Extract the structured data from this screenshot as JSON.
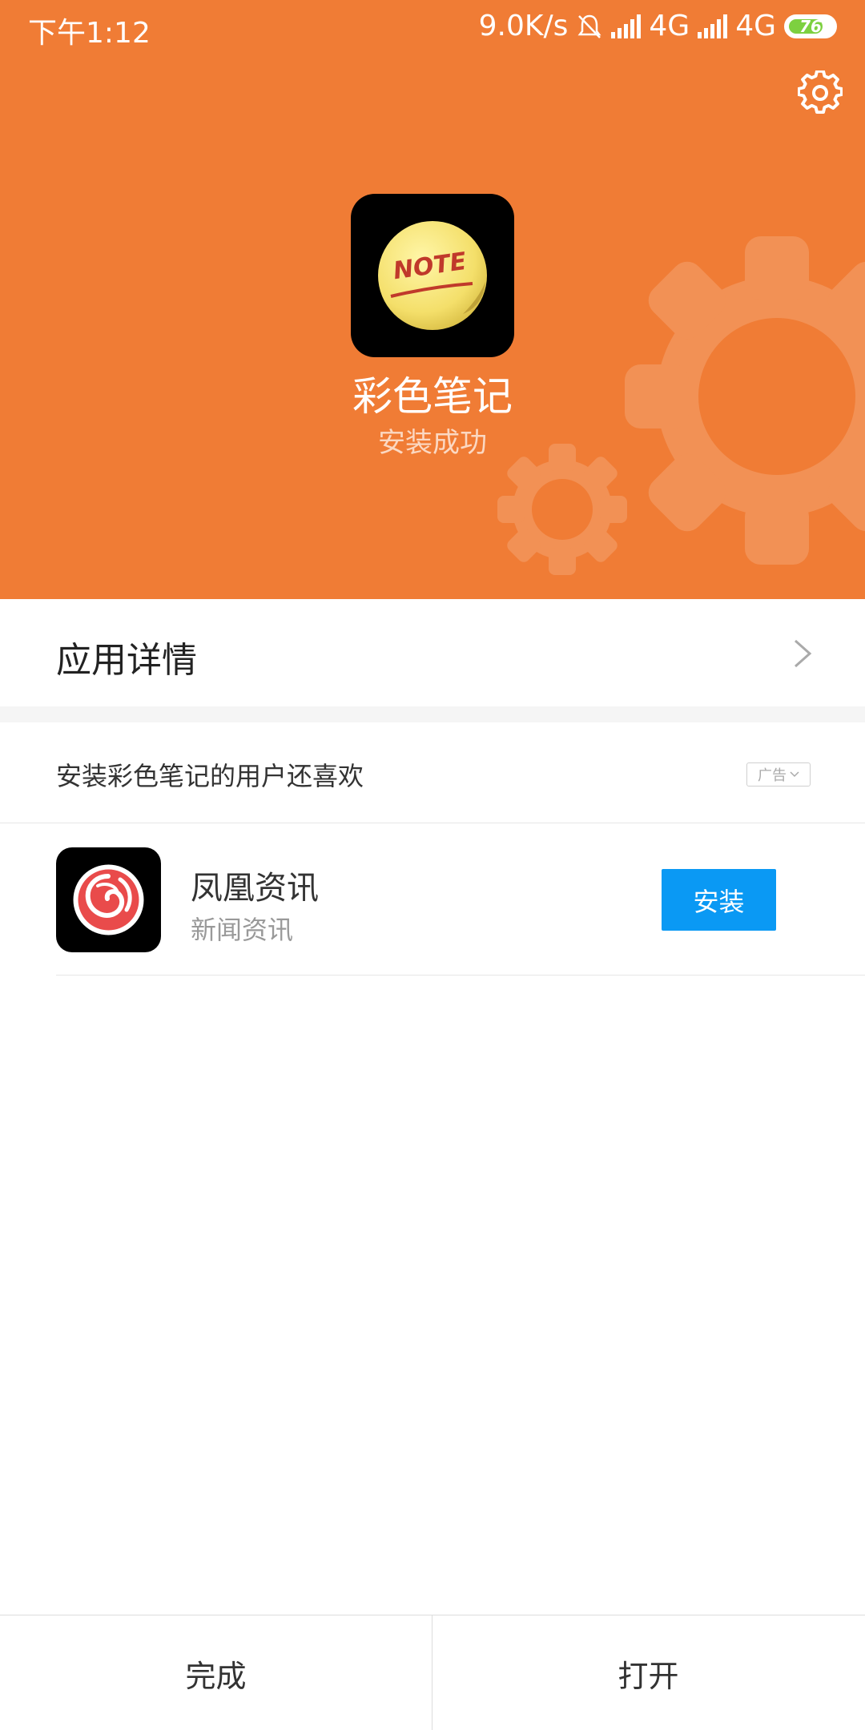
{
  "status_bar": {
    "time": "下午1:12",
    "speed": "9.0K/s",
    "network1": "4G",
    "network2": "4G",
    "battery": "76"
  },
  "header": {
    "app_name": "彩色笔记",
    "status": "安装成功",
    "icon_text": "NOTE"
  },
  "details": {
    "label": "应用详情"
  },
  "recommend": {
    "title": "安装彩色笔记的用户还喜欢",
    "ad_badge": "广告",
    "items": [
      {
        "name": "凤凰资讯",
        "category": "新闻资讯",
        "button": "安装"
      }
    ]
  },
  "bottom": {
    "done": "完成",
    "open": "打开"
  },
  "colors": {
    "header": "#F07C35",
    "install_button": "#0A99F4"
  }
}
